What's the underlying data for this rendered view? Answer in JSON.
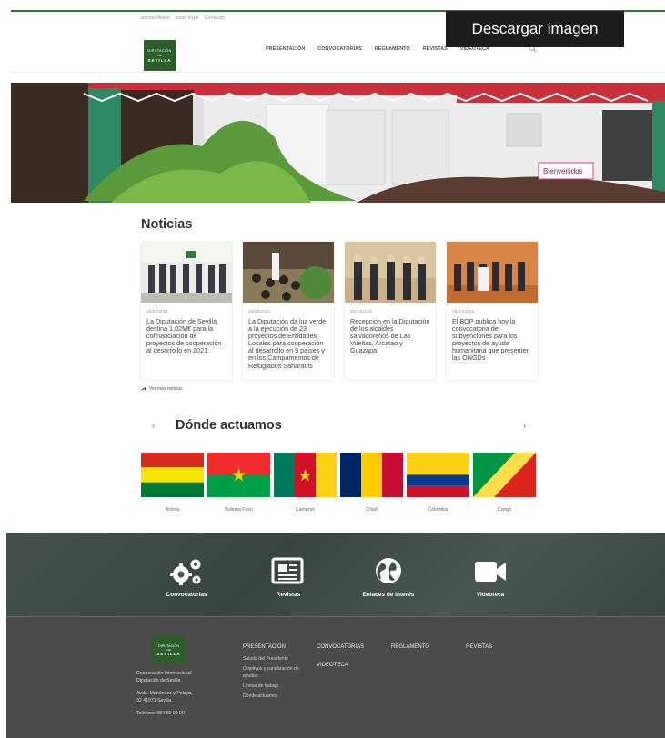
{
  "overlay": {
    "download_label": "Descargar imagen"
  },
  "utility": {
    "items": [
      "accesibilidad",
      "aviso legal",
      "Contacto"
    ]
  },
  "logo": {
    "line1": "DIPUTACIÓN",
    "line2": "DE",
    "line3": "SEVILLA"
  },
  "nav": {
    "items": [
      "PRESENTACIÓN",
      "CONVOCATORIAS",
      "REGLAMENTO",
      "REVISTAS",
      "VIDEOTECA"
    ]
  },
  "hero": {
    "banner_text": "Bienvenidos"
  },
  "news": {
    "title": "Noticias",
    "more_label": "Ver más noticias",
    "items": [
      {
        "date": "06/09/2021",
        "headline": "La Diputación de Sevilla destina 1,02M€ para la cofinanciación de proyectos de cooperación al desarrollo en 2021"
      },
      {
        "date": "29/09/2020",
        "headline": "La Diputación da luz verde a la ejecución de 23 proyectos de Entidades Locales para cooperación al desarrollo en 9 países y en los Campamentos de Refugiados Saharauis"
      },
      {
        "date": "29/10/2019",
        "headline": "Recepción en la Diputación de los alcaldes salvadoreños de Las Vueltas, Arcatao y Guazapa"
      },
      {
        "date": "09/10/2019",
        "headline": "El BOP publica hoy la convocatoria de subvenciones para los proyectos de ayuda humanitaria que presenten las ONGDs"
      }
    ]
  },
  "donde": {
    "title": "Dónde actuamos",
    "prev": "‹",
    "next": "›",
    "countries": [
      "Bolivia",
      "Burkina Faso",
      "Camerún",
      "Chad",
      "Colombia",
      "Congo"
    ]
  },
  "bar": {
    "items": [
      {
        "label": "Convocatorias",
        "icon": "gears-icon"
      },
      {
        "label": "Revistas",
        "icon": "newspaper-icon"
      },
      {
        "label": "Enlaces de interés",
        "icon": "globe-icon"
      },
      {
        "label": "Videoteca",
        "icon": "video-camera-icon"
      }
    ]
  },
  "footer": {
    "org_line1": "Cooperación Internacional",
    "org_line2": "Diputación de Sevilla",
    "addr_line1": "Avda. Menéndez y Pelayo,",
    "addr_line2": "32 41071 Sevilla",
    "phone": "Teléfono: 954 55 00 00",
    "col1": {
      "title": "PRESENTACIÓN",
      "links": [
        "Saluda del Presidente",
        "Objetivos y canalización de",
        "ayudas",
        "Líneas de trabajo",
        "Dónde actuamos"
      ]
    },
    "col2": {
      "title": "CONVOCATORIAS",
      "title2": "VIDEOTECA"
    },
    "col3": {
      "title": "REGLAMENTO"
    },
    "col4": {
      "title": "REVISTAS"
    }
  },
  "colors": {
    "brand_green": "#2a5f2a",
    "footer_bg": "#4b4b4b"
  }
}
